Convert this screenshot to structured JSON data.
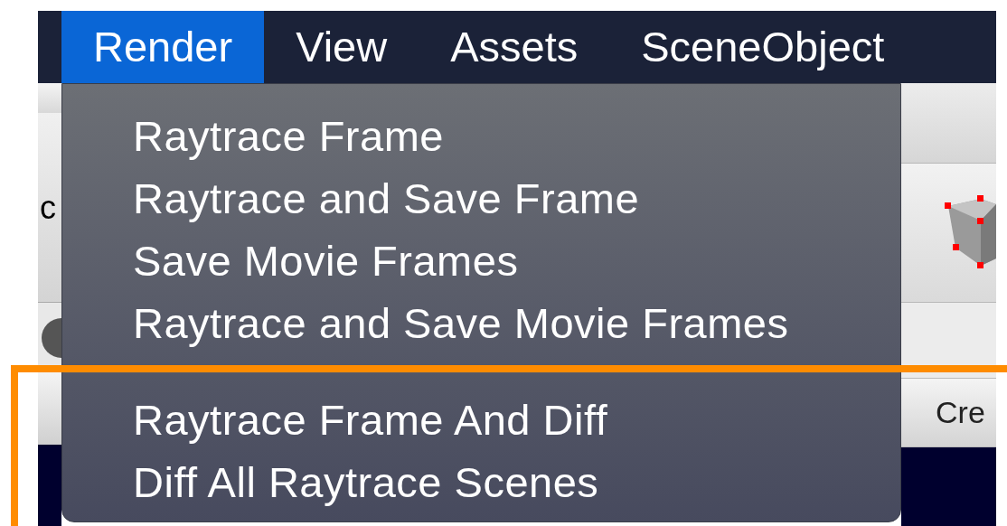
{
  "menu_bar": [
    {
      "label": "Render",
      "selected": true
    },
    {
      "label": "View",
      "selected": false
    },
    {
      "label": "Assets",
      "selected": false
    },
    {
      "label": "SceneObject",
      "selected": false
    }
  ],
  "menu": {
    "sections": [
      {
        "items": [
          "Raytrace Frame",
          "Raytrace and Save Frame",
          "Save Movie Frames",
          "Raytrace and Save Movie Frames"
        ]
      },
      {
        "items": [
          "Raytrace Frame And Diff",
          "Diff All Raytrace Scenes"
        ]
      }
    ]
  },
  "background": {
    "toolbar_label": "c",
    "button": "Cre"
  }
}
